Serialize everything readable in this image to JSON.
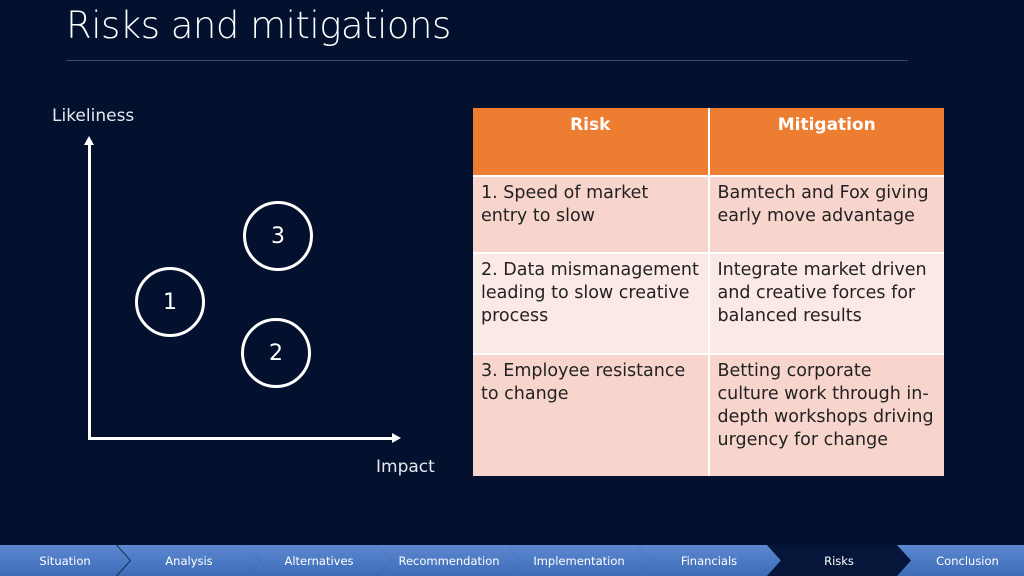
{
  "title": "Risks and mitigations",
  "matrix": {
    "y_label": "Likeliness",
    "x_label": "Impact",
    "risks": [
      "1",
      "2",
      "3"
    ]
  },
  "table": {
    "headers": [
      "Risk",
      "Mitigation"
    ],
    "rows": [
      [
        "1. Speed of market entry to slow",
        "Bamtech and Fox giving early move advantage"
      ],
      [
        "2. Data mismanagement leading to slow creative process",
        "Integrate market driven and creative forces for balanced results"
      ],
      [
        "3. Employee resistance to change",
        "Betting corporate culture work through in-depth workshops driving urgency for change"
      ]
    ],
    "header_color": "#ed7d31"
  },
  "nav": {
    "items": [
      "Situation",
      "Analysis",
      "Alternatives",
      "Recommendation",
      "Implementation",
      "Financials",
      "Risks",
      "Conclusion"
    ],
    "active": "Risks"
  }
}
